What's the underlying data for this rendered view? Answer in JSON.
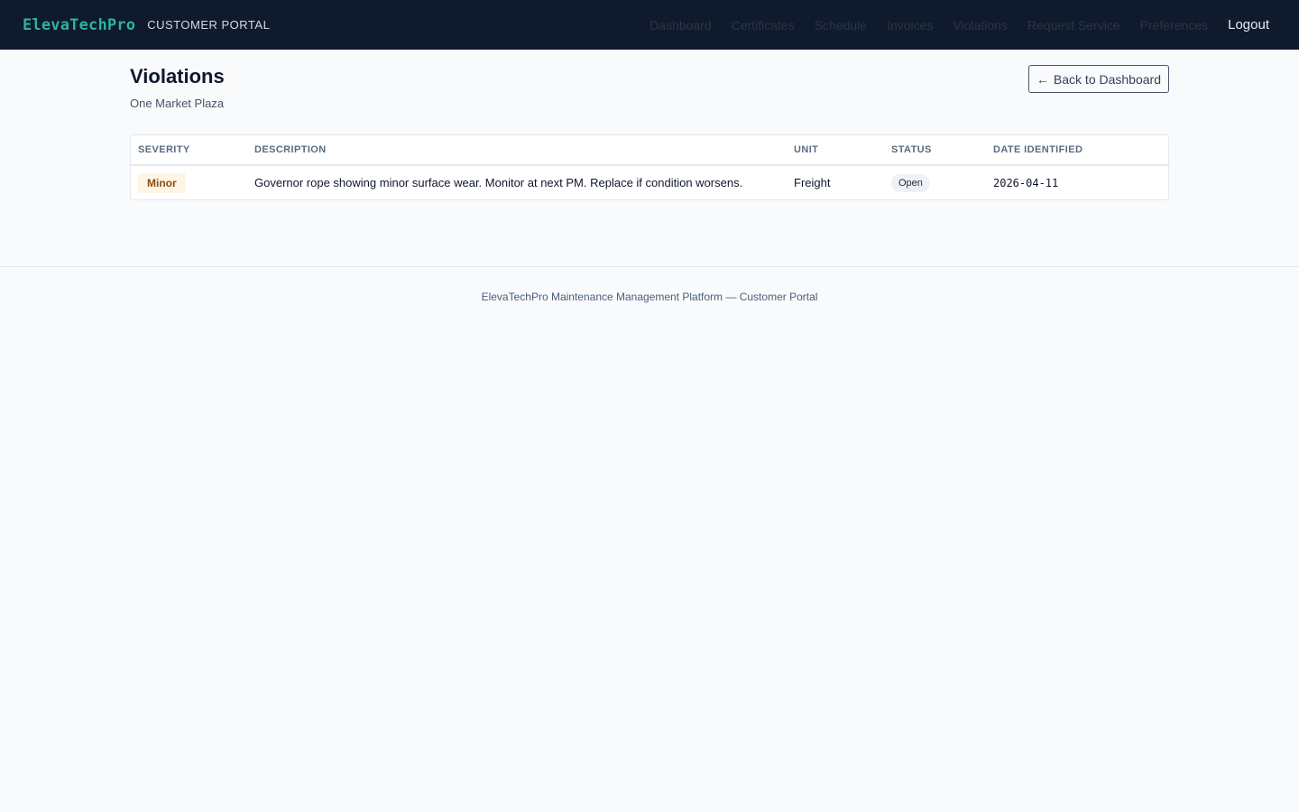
{
  "header": {
    "brand": "ElevaTechPro",
    "portal_label": "CUSTOMER PORTAL",
    "nav": [
      "Dashboard",
      "Certificates",
      "Schedule",
      "Invoices",
      "Violations",
      "Request Service",
      "Preferences"
    ],
    "logout": "Logout"
  },
  "page": {
    "title": "Violations",
    "subtitle": "One Market Plaza",
    "back_button": "Back to Dashboard",
    "back_icon": "←"
  },
  "table": {
    "columns": [
      "SEVERITY",
      "DESCRIPTION",
      "UNIT",
      "STATUS",
      "DATE IDENTIFIED"
    ],
    "rows": [
      {
        "severity": "Minor",
        "description": "Governor rope showing minor surface wear. Monitor at next PM. Replace if condition worsens.",
        "unit": "Freight",
        "status": "Open",
        "date": "2026-04-11"
      }
    ]
  },
  "footer": {
    "text": "ElevaTechPro Maintenance Management Platform — Customer Portal"
  },
  "colors": {
    "topbar_bg": "#0f1a2c",
    "brand": "#2bb3a6",
    "minor_badge_bg": "#fef6e4",
    "minor_badge_text": "#8a4b0f"
  }
}
